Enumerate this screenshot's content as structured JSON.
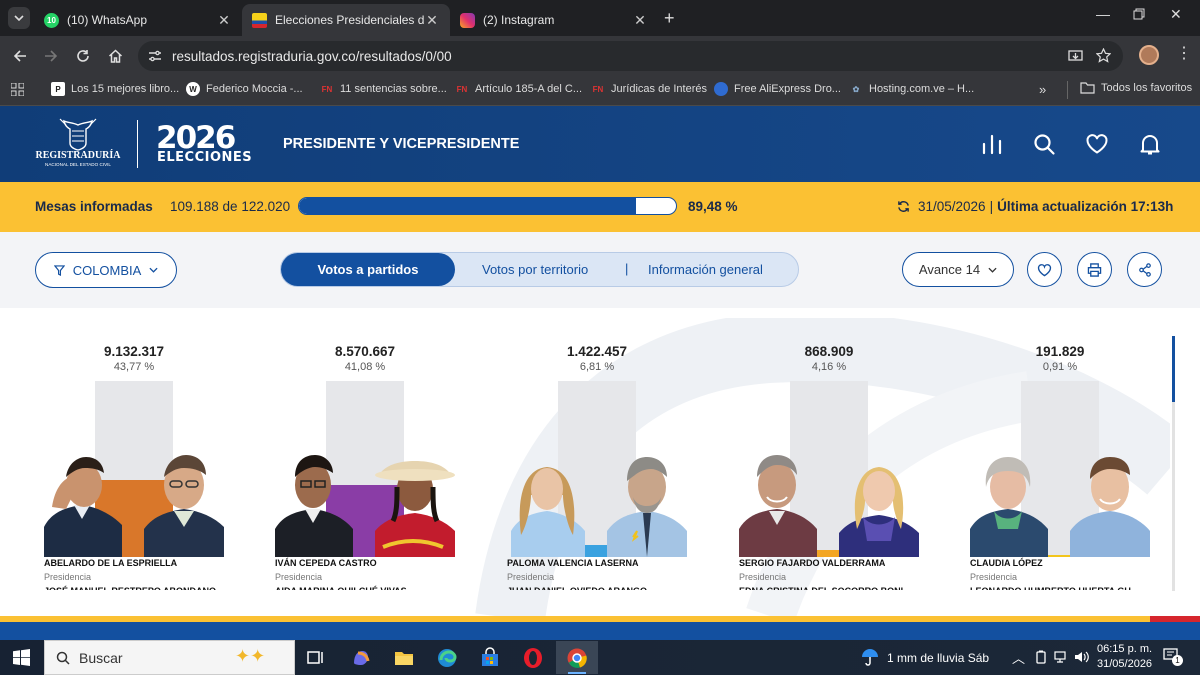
{
  "browser": {
    "tabs": [
      {
        "title": "(10) WhatsApp",
        "badge": "10",
        "active": false
      },
      {
        "title": "Elecciones Presidenciales de la R",
        "active": true
      },
      {
        "title": "(2) Instagram",
        "active": false
      }
    ],
    "url": "resultados.registraduria.gov.co/resultados/0/00",
    "bookmarks": [
      "Los 15 mejores libro...",
      "Federico Moccia -...",
      "11 sentencias sobre...",
      "Artículo 185-A del C...",
      "Jurídicas de Interés",
      "Free AliExpress Dro...",
      "Hosting.com.ve – H..."
    ],
    "all_favorites": "Todos los favoritos",
    "more": "»"
  },
  "header": {
    "org": "REGISTRADURÍA",
    "org_sub": "NACIONAL DEL ESTADO CIVIL",
    "year": "2026",
    "elecciones": "ELECCIONES",
    "section": "PRESIDENTE Y VICEPRESIDENTE"
  },
  "mesas": {
    "label": "Mesas informadas",
    "count": "109.188 de 122.020",
    "percent": "89,48 %",
    "progress": 0.8948,
    "date": "31/05/2026",
    "separator": "|",
    "updated": "Última actualización 17:13h"
  },
  "filters": {
    "region": "COLOMBIA",
    "tabs": [
      "Votos a partidos",
      "Votos por territorio",
      "Información general"
    ],
    "tab_separator": "|",
    "avance": "Avance 14"
  },
  "candidates": [
    {
      "votes": "9.132.317",
      "percent": "43,77 %",
      "share": 0.4377,
      "color": "#d9772a",
      "name": "ABELARDO DE LA ESPRIELLA",
      "role": "Presidencia",
      "vice": "JOSÉ MANUEL RESTREPO ABONDANO"
    },
    {
      "votes": "8.570.667",
      "percent": "41,08 %",
      "share": 0.4108,
      "color": "#8a3da6",
      "name": "IVÁN CEPEDA CASTRO",
      "role": "Presidencia",
      "vice": "AIDA MARINA QUILCUÉ VIVAS"
    },
    {
      "votes": "1.422.457",
      "percent": "6,81 %",
      "share": 0.0681,
      "color": "#3aa2e0",
      "name": "PALOMA VALENCIA LASERNA",
      "role": "Presidencia",
      "vice": "JUAN DANIEL OVIEDO ARANGO"
    },
    {
      "votes": "868.909",
      "percent": "4,16 %",
      "share": 0.0416,
      "color": "#f3a624",
      "name": "SERGIO FAJARDO VALDERRAMA",
      "role": "Presidencia",
      "vice": "EDNA CRISTINA DEL SOCORRO BONI"
    },
    {
      "votes": "191.829",
      "percent": "0,91 %",
      "share": 0.0091,
      "color": "#f2c51c",
      "name": "CLAUDIA LÓPEZ",
      "role": "Presidencia",
      "vice": "LEONARDO HUMBERTO HUERTA GU"
    }
  ],
  "taskbar": {
    "search": "Buscar",
    "weather": "1 mm de lluvia Sáb",
    "time": "06:15 p. m.",
    "date": "31/05/2026",
    "notifications": "1"
  }
}
